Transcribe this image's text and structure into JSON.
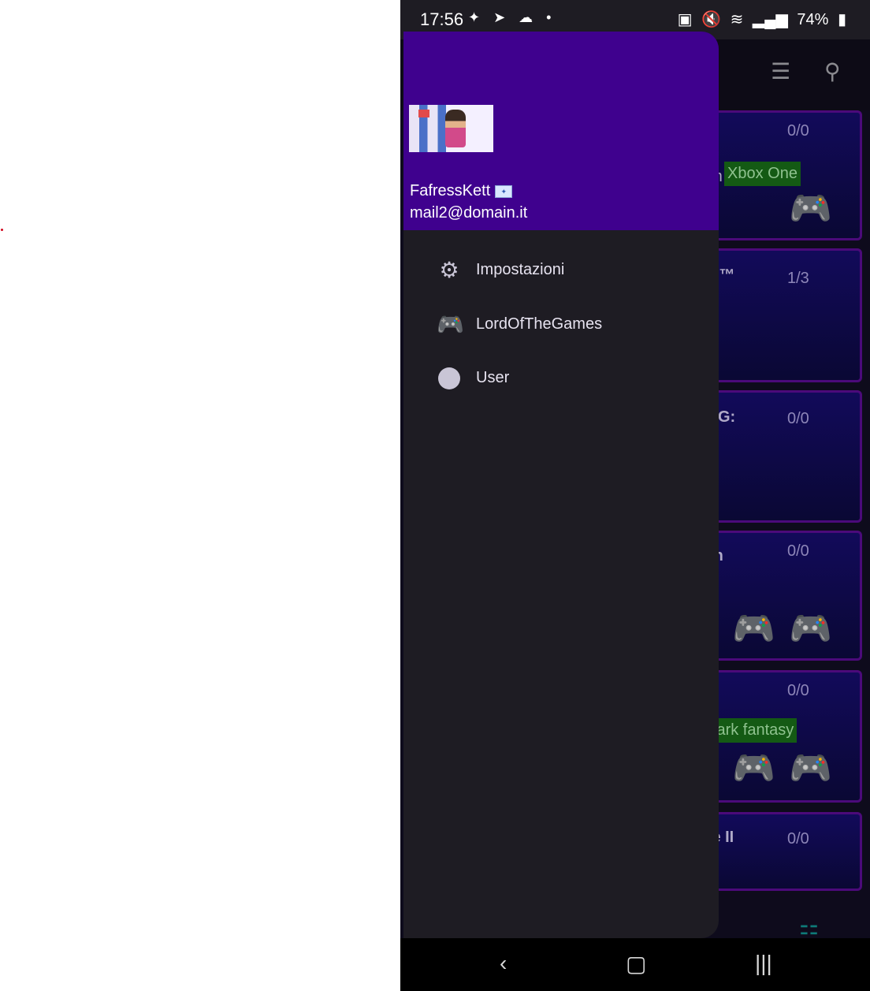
{
  "status_bar": {
    "time": "17:56",
    "left_icons": "✦ ➤ ☁ •",
    "battery": "74%"
  },
  "background_app": {
    "cards": [
      {
        "text": "am",
        "count": "0/0",
        "tag": "Xbox One",
        "pads": 1
      },
      {
        "text": "vn™",
        "count": "1/3",
        "tag": "",
        "pads": 0
      },
      {
        "text": "ING:",
        "count": "0/0",
        "tag": "",
        "pads": 0
      },
      {
        "text": "lan",
        "count": "0/0",
        "tag": "",
        "pads": 2
      },
      {
        "text": "",
        "count": "0/0",
        "tag": "Dark fantasy",
        "pads": 2
      },
      {
        "text": "rte II",
        "count": "0/0",
        "tag": "",
        "pads": 0
      }
    ]
  },
  "drawer": {
    "header": {
      "name": "FafressKett",
      "email": "mail2@domain.it"
    },
    "items": [
      {
        "label": "Impostazioni",
        "icon": "gear-icon"
      },
      {
        "label": "LordOfTheGames",
        "icon": "gamepad-icon"
      },
      {
        "label": "User",
        "icon": "circle-icon"
      }
    ]
  },
  "colors": {
    "drawer_header": "#3f018e",
    "drawer_bg": "#1e1c23",
    "tag_green": "#145a14",
    "card_border": "#4b0a7a"
  }
}
